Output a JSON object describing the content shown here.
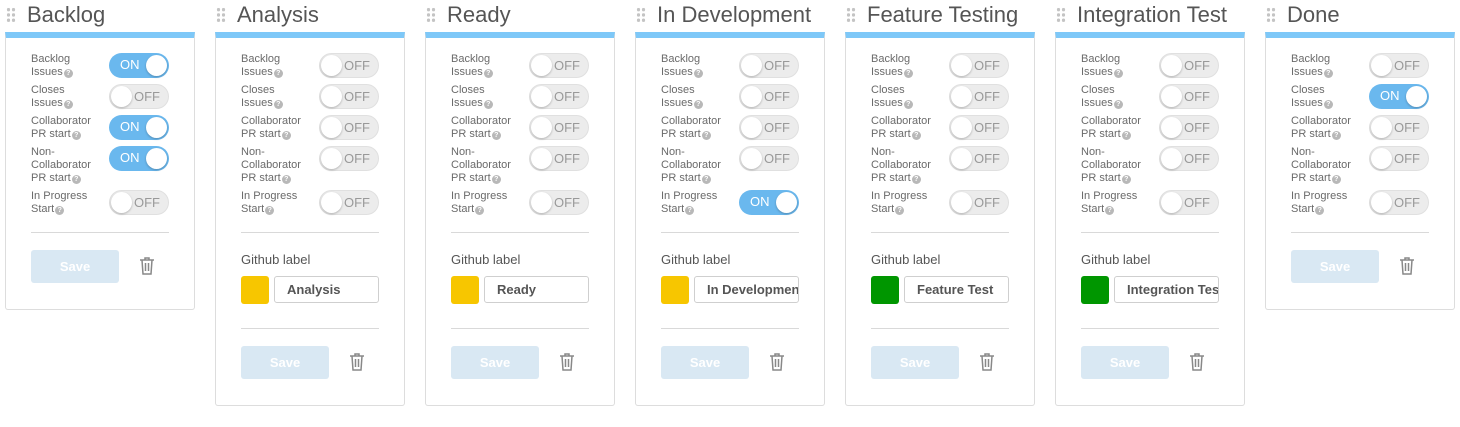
{
  "columns": [
    {
      "title": "Backlog",
      "toggles": [
        {
          "label": "Backlog\nIssues",
          "value": "ON"
        },
        {
          "label": "Closes\nIssues",
          "value": "OFF"
        },
        {
          "label": "Collaborator\nPR start",
          "value": "ON"
        },
        {
          "label": "Non-\nCollaborator\nPR start",
          "value": "ON"
        },
        {
          "label": "In Progress\nStart",
          "value": "OFF"
        }
      ],
      "github": null,
      "save_label": "Save"
    },
    {
      "title": "Analysis",
      "toggles": [
        {
          "label": "Backlog\nIssues",
          "value": "OFF"
        },
        {
          "label": "Closes\nIssues",
          "value": "OFF"
        },
        {
          "label": "Collaborator\nPR start",
          "value": "OFF"
        },
        {
          "label": "Non-\nCollaborator\nPR start",
          "value": "OFF"
        },
        {
          "label": "In Progress\nStart",
          "value": "OFF"
        }
      ],
      "github": {
        "title": "Github label",
        "color": "#f7c600",
        "value": "Analysis"
      },
      "save_label": "Save"
    },
    {
      "title": "Ready",
      "toggles": [
        {
          "label": "Backlog\nIssues",
          "value": "OFF"
        },
        {
          "label": "Closes\nIssues",
          "value": "OFF"
        },
        {
          "label": "Collaborator\nPR start",
          "value": "OFF"
        },
        {
          "label": "Non-\nCollaborator\nPR start",
          "value": "OFF"
        },
        {
          "label": "In Progress\nStart",
          "value": "OFF"
        }
      ],
      "github": {
        "title": "Github label",
        "color": "#f7c600",
        "value": "Ready"
      },
      "save_label": "Save"
    },
    {
      "title": "In Development",
      "toggles": [
        {
          "label": "Backlog\nIssues",
          "value": "OFF"
        },
        {
          "label": "Closes\nIssues",
          "value": "OFF"
        },
        {
          "label": "Collaborator\nPR start",
          "value": "OFF"
        },
        {
          "label": "Non-\nCollaborator\nPR start",
          "value": "OFF"
        },
        {
          "label": "In Progress\nStart",
          "value": "ON"
        }
      ],
      "github": {
        "title": "Github label",
        "color": "#f7c600",
        "value": "In Development"
      },
      "save_label": "Save"
    },
    {
      "title": "Feature Testing",
      "toggles": [
        {
          "label": "Backlog\nIssues",
          "value": "OFF"
        },
        {
          "label": "Closes\nIssues",
          "value": "OFF"
        },
        {
          "label": "Collaborator\nPR start",
          "value": "OFF"
        },
        {
          "label": "Non-\nCollaborator\nPR start",
          "value": "OFF"
        },
        {
          "label": "In Progress\nStart",
          "value": "OFF"
        }
      ],
      "github": {
        "title": "Github label",
        "color": "#009600",
        "value": "Feature Test"
      },
      "save_label": "Save"
    },
    {
      "title": "Integration Test",
      "toggles": [
        {
          "label": "Backlog\nIssues",
          "value": "OFF"
        },
        {
          "label": "Closes\nIssues",
          "value": "OFF"
        },
        {
          "label": "Collaborator\nPR start",
          "value": "OFF"
        },
        {
          "label": "Non-\nCollaborator\nPR start",
          "value": "OFF"
        },
        {
          "label": "In Progress\nStart",
          "value": "OFF"
        }
      ],
      "github": {
        "title": "Github label",
        "color": "#009600",
        "value": "Integration Test"
      },
      "save_label": "Save"
    },
    {
      "title": "Done",
      "toggles": [
        {
          "label": "Backlog\nIssues",
          "value": "OFF"
        },
        {
          "label": "Closes\nIssues",
          "value": "ON"
        },
        {
          "label": "Collaborator\nPR start",
          "value": "OFF"
        },
        {
          "label": "Non-\nCollaborator\nPR start",
          "value": "OFF"
        },
        {
          "label": "In Progress\nStart",
          "value": "OFF"
        }
      ],
      "github": null,
      "save_label": "Save"
    }
  ],
  "icons": {
    "drag": "drag-handle-icon",
    "help": "question-circle-icon",
    "delete": "trash-icon"
  },
  "colors": {
    "accent": "#7ec8f8",
    "toggle_on": "#6ab8ee",
    "save_disabled": "#d9e8f3"
  }
}
